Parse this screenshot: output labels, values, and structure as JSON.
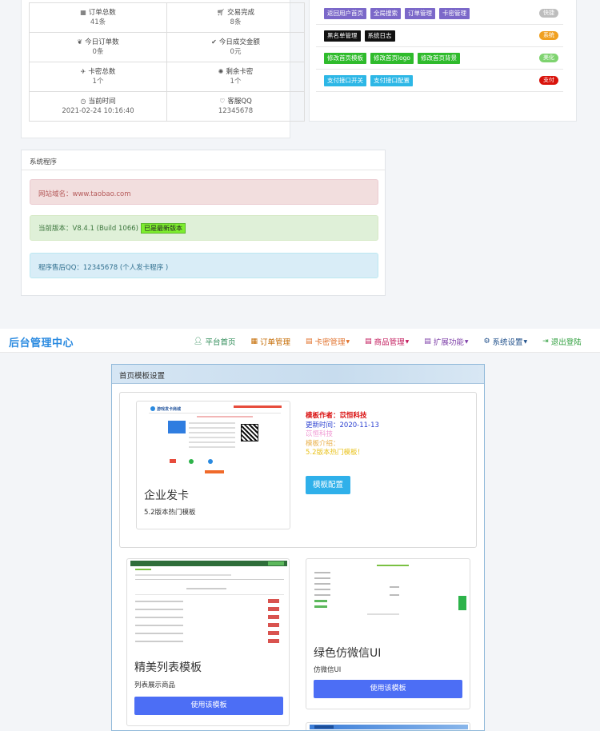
{
  "stats": [
    {
      "icon": "grid-icon",
      "label": "订单总数",
      "value": "41条"
    },
    {
      "icon": "cart-icon",
      "label": "交易完成",
      "value": "8条"
    },
    {
      "icon": "leaf-icon",
      "label": "今日订单数",
      "value": "0条"
    },
    {
      "icon": "check-icon",
      "label": "今日成交金额",
      "value": "0元"
    },
    {
      "icon": "plane-icon",
      "label": "卡密总数",
      "value": "1个"
    },
    {
      "icon": "asterisk-icon",
      "label": "剩余卡密",
      "value": "1个"
    },
    {
      "icon": "clock-icon",
      "label": "当前时间",
      "value": "2021-02-24 10:16:40"
    },
    {
      "icon": "heart-icon",
      "label": "客服QQ",
      "value": "12345678"
    }
  ],
  "quick_links": {
    "rows": [
      {
        "buttons": [
          "返回用户首页",
          "全局搜索",
          "订单管理",
          "卡密管理"
        ],
        "tag": "快捷"
      },
      {
        "buttons": [
          "黑名单管理",
          "系统日志"
        ],
        "tag": "系统"
      },
      {
        "buttons": [
          "修改首页模板",
          "修改首页logo",
          "修改首页背景"
        ],
        "tag": "美化"
      },
      {
        "buttons": [
          "支付接口开关",
          "支付接口配置"
        ],
        "tag": "支付"
      }
    ]
  },
  "system": {
    "title": "系统程序",
    "site_domain": "网站域名：www.taobao.com",
    "version": "当前版本：V8.4.1 (Build 1066)",
    "version_badge": "已是最新版本",
    "support_qq": "程序售后QQ：12345678 (个人发卡程序 )"
  },
  "navbar": {
    "brand": "后台管理中心",
    "items": [
      "平台首页",
      "订单管理",
      "卡密管理",
      "商品管理",
      "扩展功能",
      "系统设置",
      "退出登陆"
    ]
  },
  "template_panel": {
    "title": "首页模板设置",
    "current": {
      "name": "企业发卡",
      "desc": "5.2版本热门模板",
      "author": "模板作者：苡恒科技",
      "updated": "更新时间：2020-11-13",
      "company": "苡恒科技",
      "intro_label": "模板介绍：",
      "intro": "5.2版本热门模板！",
      "config_button": "模板配置",
      "thumb_title": "游戏发卡商城"
    },
    "others": [
      {
        "name": "精美列表模板",
        "desc": "列表展示商品",
        "button": "使用该模板"
      },
      {
        "name": "绿色仿微信UI",
        "desc": "仿微信UI",
        "button": "使用该模板"
      }
    ]
  },
  "colors": {
    "brand": "#2a8ae0",
    "link_purple": "#7b68c9",
    "tag_grey": "#bdbdbd",
    "tag_orange": "#f0a020",
    "tag_green": "#7ed36f",
    "tag_red": "#d9130b"
  }
}
